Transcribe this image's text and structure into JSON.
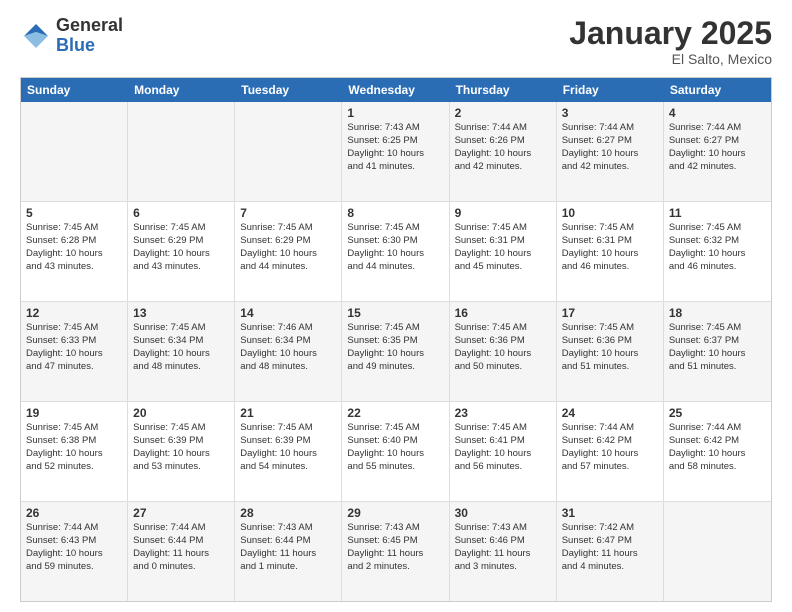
{
  "logo": {
    "general": "General",
    "blue": "Blue"
  },
  "header": {
    "title": "January 2025",
    "subtitle": "El Salto, Mexico"
  },
  "weekdays": [
    "Sunday",
    "Monday",
    "Tuesday",
    "Wednesday",
    "Thursday",
    "Friday",
    "Saturday"
  ],
  "weeks": [
    [
      {
        "day": "",
        "lines": []
      },
      {
        "day": "",
        "lines": []
      },
      {
        "day": "",
        "lines": []
      },
      {
        "day": "1",
        "lines": [
          "Sunrise: 7:43 AM",
          "Sunset: 6:25 PM",
          "Daylight: 10 hours",
          "and 41 minutes."
        ]
      },
      {
        "day": "2",
        "lines": [
          "Sunrise: 7:44 AM",
          "Sunset: 6:26 PM",
          "Daylight: 10 hours",
          "and 42 minutes."
        ]
      },
      {
        "day": "3",
        "lines": [
          "Sunrise: 7:44 AM",
          "Sunset: 6:27 PM",
          "Daylight: 10 hours",
          "and 42 minutes."
        ]
      },
      {
        "day": "4",
        "lines": [
          "Sunrise: 7:44 AM",
          "Sunset: 6:27 PM",
          "Daylight: 10 hours",
          "and 42 minutes."
        ]
      }
    ],
    [
      {
        "day": "5",
        "lines": [
          "Sunrise: 7:45 AM",
          "Sunset: 6:28 PM",
          "Daylight: 10 hours",
          "and 43 minutes."
        ]
      },
      {
        "day": "6",
        "lines": [
          "Sunrise: 7:45 AM",
          "Sunset: 6:29 PM",
          "Daylight: 10 hours",
          "and 43 minutes."
        ]
      },
      {
        "day": "7",
        "lines": [
          "Sunrise: 7:45 AM",
          "Sunset: 6:29 PM",
          "Daylight: 10 hours",
          "and 44 minutes."
        ]
      },
      {
        "day": "8",
        "lines": [
          "Sunrise: 7:45 AM",
          "Sunset: 6:30 PM",
          "Daylight: 10 hours",
          "and 44 minutes."
        ]
      },
      {
        "day": "9",
        "lines": [
          "Sunrise: 7:45 AM",
          "Sunset: 6:31 PM",
          "Daylight: 10 hours",
          "and 45 minutes."
        ]
      },
      {
        "day": "10",
        "lines": [
          "Sunrise: 7:45 AM",
          "Sunset: 6:31 PM",
          "Daylight: 10 hours",
          "and 46 minutes."
        ]
      },
      {
        "day": "11",
        "lines": [
          "Sunrise: 7:45 AM",
          "Sunset: 6:32 PM",
          "Daylight: 10 hours",
          "and 46 minutes."
        ]
      }
    ],
    [
      {
        "day": "12",
        "lines": [
          "Sunrise: 7:45 AM",
          "Sunset: 6:33 PM",
          "Daylight: 10 hours",
          "and 47 minutes."
        ]
      },
      {
        "day": "13",
        "lines": [
          "Sunrise: 7:45 AM",
          "Sunset: 6:34 PM",
          "Daylight: 10 hours",
          "and 48 minutes."
        ]
      },
      {
        "day": "14",
        "lines": [
          "Sunrise: 7:46 AM",
          "Sunset: 6:34 PM",
          "Daylight: 10 hours",
          "and 48 minutes."
        ]
      },
      {
        "day": "15",
        "lines": [
          "Sunrise: 7:45 AM",
          "Sunset: 6:35 PM",
          "Daylight: 10 hours",
          "and 49 minutes."
        ]
      },
      {
        "day": "16",
        "lines": [
          "Sunrise: 7:45 AM",
          "Sunset: 6:36 PM",
          "Daylight: 10 hours",
          "and 50 minutes."
        ]
      },
      {
        "day": "17",
        "lines": [
          "Sunrise: 7:45 AM",
          "Sunset: 6:36 PM",
          "Daylight: 10 hours",
          "and 51 minutes."
        ]
      },
      {
        "day": "18",
        "lines": [
          "Sunrise: 7:45 AM",
          "Sunset: 6:37 PM",
          "Daylight: 10 hours",
          "and 51 minutes."
        ]
      }
    ],
    [
      {
        "day": "19",
        "lines": [
          "Sunrise: 7:45 AM",
          "Sunset: 6:38 PM",
          "Daylight: 10 hours",
          "and 52 minutes."
        ]
      },
      {
        "day": "20",
        "lines": [
          "Sunrise: 7:45 AM",
          "Sunset: 6:39 PM",
          "Daylight: 10 hours",
          "and 53 minutes."
        ]
      },
      {
        "day": "21",
        "lines": [
          "Sunrise: 7:45 AM",
          "Sunset: 6:39 PM",
          "Daylight: 10 hours",
          "and 54 minutes."
        ]
      },
      {
        "day": "22",
        "lines": [
          "Sunrise: 7:45 AM",
          "Sunset: 6:40 PM",
          "Daylight: 10 hours",
          "and 55 minutes."
        ]
      },
      {
        "day": "23",
        "lines": [
          "Sunrise: 7:45 AM",
          "Sunset: 6:41 PM",
          "Daylight: 10 hours",
          "and 56 minutes."
        ]
      },
      {
        "day": "24",
        "lines": [
          "Sunrise: 7:44 AM",
          "Sunset: 6:42 PM",
          "Daylight: 10 hours",
          "and 57 minutes."
        ]
      },
      {
        "day": "25",
        "lines": [
          "Sunrise: 7:44 AM",
          "Sunset: 6:42 PM",
          "Daylight: 10 hours",
          "and 58 minutes."
        ]
      }
    ],
    [
      {
        "day": "26",
        "lines": [
          "Sunrise: 7:44 AM",
          "Sunset: 6:43 PM",
          "Daylight: 10 hours",
          "and 59 minutes."
        ]
      },
      {
        "day": "27",
        "lines": [
          "Sunrise: 7:44 AM",
          "Sunset: 6:44 PM",
          "Daylight: 11 hours",
          "and 0 minutes."
        ]
      },
      {
        "day": "28",
        "lines": [
          "Sunrise: 7:43 AM",
          "Sunset: 6:44 PM",
          "Daylight: 11 hours",
          "and 1 minute."
        ]
      },
      {
        "day": "29",
        "lines": [
          "Sunrise: 7:43 AM",
          "Sunset: 6:45 PM",
          "Daylight: 11 hours",
          "and 2 minutes."
        ]
      },
      {
        "day": "30",
        "lines": [
          "Sunrise: 7:43 AM",
          "Sunset: 6:46 PM",
          "Daylight: 11 hours",
          "and 3 minutes."
        ]
      },
      {
        "day": "31",
        "lines": [
          "Sunrise: 7:42 AM",
          "Sunset: 6:47 PM",
          "Daylight: 11 hours",
          "and 4 minutes."
        ]
      },
      {
        "day": "",
        "lines": []
      }
    ]
  ],
  "shaded_rows": [
    0,
    2,
    4
  ],
  "colors": {
    "header_bg": "#2a6db5",
    "shaded_cell": "#f5f5f5"
  }
}
